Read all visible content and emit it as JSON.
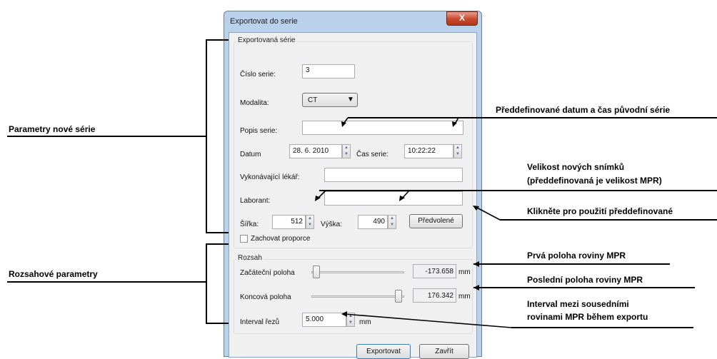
{
  "dialog": {
    "title": "Exportovat do serie",
    "close_glyph": "X",
    "exported_series": {
      "title": "Exportovaná série",
      "series_number_label": "Číslo serie:",
      "series_number_value": "3",
      "modality_label": "Modalita:",
      "modality_value": "CT",
      "description_label": "Popis serie:",
      "description_value": "",
      "date_label": "Datum",
      "date_value": "28.  6. 2010",
      "time_label": "Čas serie:",
      "time_value": "10:22:22",
      "physician_label": "Vykonávající lékář:",
      "physician_value": "",
      "technician_label": "Laborant:",
      "technician_value": "",
      "width_label": "Šířka:",
      "width_value": "512",
      "height_label": "Výška:",
      "height_value": "490",
      "preset_button": "Předvolené",
      "keep_ratio_label": "Zachovat proporce",
      "keep_ratio_checked": false
    },
    "range": {
      "title": "Rozsah",
      "start_label": "Začáteční poloha",
      "start_value": "-173.658",
      "start_unit": "mm",
      "end_label": "Koncová poloha",
      "end_value": "176.342",
      "end_unit": "mm",
      "interval_label": "Interval řezů",
      "interval_value": "5.000",
      "interval_unit": "mm"
    },
    "export_button": "Exportovat",
    "close_button": "Zavřít"
  },
  "annotations": {
    "new_series_params": "Parametry nové série",
    "range_params": "Rozsahové parametry",
    "predefined_datetime": "Předdefinované datum a čas původní série",
    "image_size_line1": "Velikost nových snímků",
    "image_size_line2": "(předdefinovaná je velikost MPR)",
    "click_predefined": "Klikněte pro použití předdefinované",
    "first_mpr": "Prvá poloha roviny MPR",
    "last_mpr": "Poslední poloha roviny MPR",
    "interval_line1": "Interval mezi sousedními",
    "interval_line2": "rovinami MPR během exportu"
  },
  "icons": {
    "spin_up": "▲",
    "spin_down": "▼",
    "combo_arrow": "▼"
  }
}
